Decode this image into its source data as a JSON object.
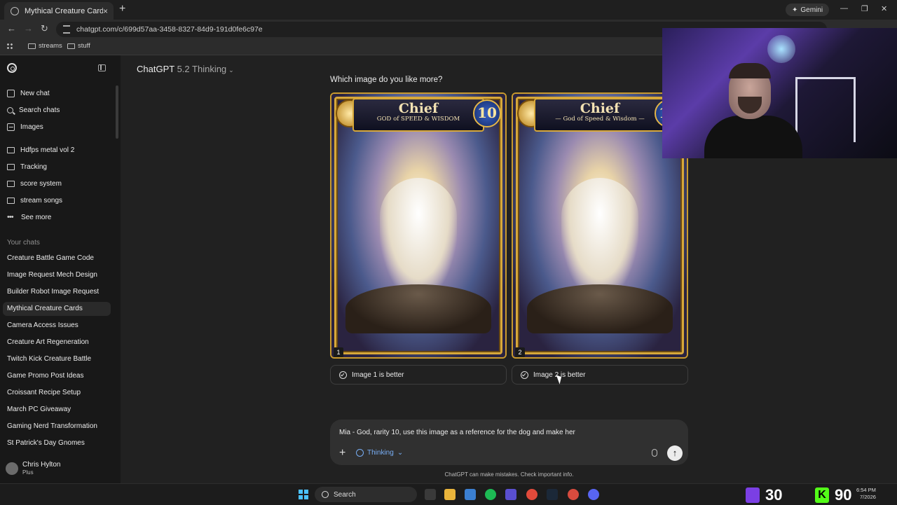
{
  "browser": {
    "tab_title": "Mythical Creature Cards",
    "tab_close": "×",
    "new_tab": "+",
    "gemini_label": "Gemini",
    "window_controls": [
      "—",
      "❐",
      "✕"
    ],
    "url": "chatgpt.com/c/699d57aa-3458-8327-84d9-191d0fe6c97e",
    "bookmarks": [
      "streams",
      "stuff"
    ]
  },
  "sidebar": {
    "primary": [
      {
        "label": "New chat",
        "icon": "new-chat-icon"
      },
      {
        "label": "Search chats",
        "icon": "search-icon"
      },
      {
        "label": "Images",
        "icon": "image-icon"
      }
    ],
    "projects": [
      "Hdfps metal vol 2",
      "Tracking",
      "score system",
      "stream songs"
    ],
    "see_more": "See more",
    "your_chats_label": "Your chats",
    "chats": [
      "Creature Battle Game Code",
      "Image Request Mech Design",
      "Builder Robot Image Request",
      "Mythical Creature Cards",
      "Camera Access Issues",
      "Creature Art Regeneration",
      "Twitch Kick Creature Battle",
      "Game Promo Post Ideas",
      "Croissant Recipe Setup",
      "March PC Giveaway",
      "Gaming Nerd Transformation",
      "St Patrick's Day Gnomes"
    ],
    "active_chat": "Mythical Creature Cards",
    "user": {
      "name": "Chris Hylton",
      "plan": "Plus"
    }
  },
  "header": {
    "model": "ChatGPT",
    "version": "5.2 Thinking",
    "chevron": "⌄"
  },
  "comparison": {
    "question": "Which image do you like more?",
    "cards": [
      {
        "number": "1",
        "name": "Chief",
        "subtitle": "GOD of SPEED & WISDOM",
        "rarity": "10"
      },
      {
        "number": "2",
        "name": "Chief",
        "subtitle": "— God of Speed & Wisdom —",
        "rarity": "10"
      }
    ],
    "choices": [
      "Image 1 is better",
      "Image 2 is better"
    ]
  },
  "composer": {
    "text": "Mia - God, rarity 10, use this image as a reference for the dog and make her",
    "plus": "+",
    "mode": "Thinking",
    "mode_chevron": "⌄",
    "send": "↑"
  },
  "disclaimer": "ChatGPT can make mistakes. Check important info.",
  "taskbar": {
    "search": "Search",
    "twitch_count": "30",
    "kick_count": "90",
    "time": "6:54 PM",
    "date": "7/2026"
  }
}
